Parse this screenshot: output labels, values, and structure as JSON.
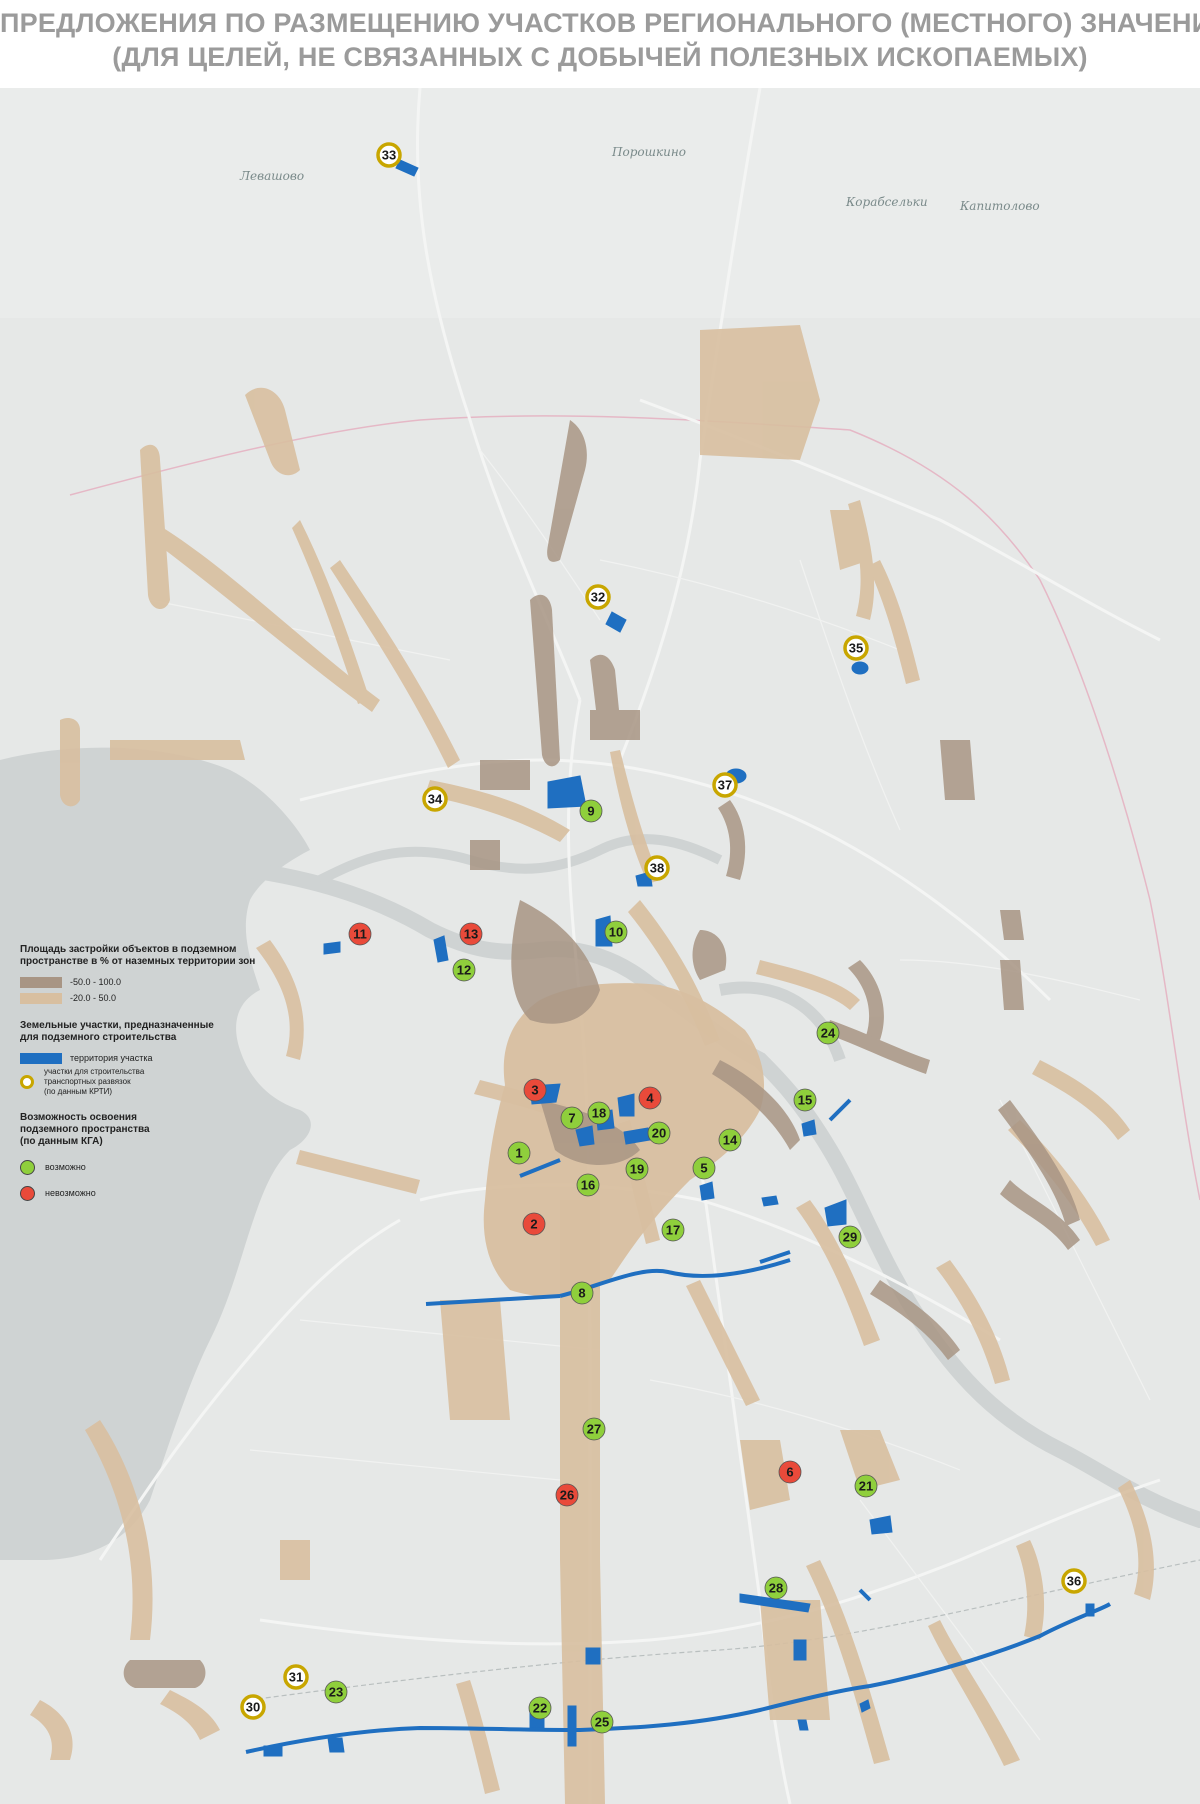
{
  "title": {
    "line1": "ПРЕДЛОЖЕНИЯ ПО РАЗМЕЩЕНИЮ УЧАСТКОВ РЕГИОНАЛЬНОГО (МЕСТНОГО) ЗНАЧЕНИЯ",
    "line2": "(ДЛЯ ЦЕЛЕЙ, НЕ СВЯЗАННЫХ С ДОБЫЧЕЙ ПОЛЕЗНЫХ ИСКОПАЕМЫХ)"
  },
  "colors": {
    "background": "#e6e8e7",
    "water": "#cfd3d3",
    "zone_high": "#a89584",
    "zone_low": "#d8bfa0",
    "site": "#1f6fc1",
    "ring": "#c8a600",
    "possible": "#8fcf3c",
    "impossible": "#e94a3a"
  },
  "places": [
    {
      "name": "Левашово"
    },
    {
      "name": "Порошкино"
    },
    {
      "name": "Корабсельки"
    },
    {
      "name": "Капитолово"
    }
  ],
  "legend": {
    "zone_heading": "Площадь застройки объектов в подземном\nпространстве в % от наземных территории зон",
    "zone_high_label": "-50.0 - 100.0",
    "zone_low_label": "-20.0 - 50.0",
    "plots_heading": "Земельные участки, предназначенные\nдля подземного строительства",
    "plot_label": "территория участка",
    "ring_label": "участки для строительства\nтранспортных развязок\n(по данным КРТИ)",
    "possibility_heading": "Возможность освоения\nподземного пространства\n(по данным КГА)",
    "possible_label": "возможно",
    "impossible_label": "невозможно"
  },
  "markers": [
    {
      "num": "1",
      "type": "possible"
    },
    {
      "num": "2",
      "type": "impossible"
    },
    {
      "num": "3",
      "type": "impossible"
    },
    {
      "num": "4",
      "type": "impossible"
    },
    {
      "num": "5",
      "type": "possible"
    },
    {
      "num": "6",
      "type": "impossible"
    },
    {
      "num": "7",
      "type": "possible"
    },
    {
      "num": "8",
      "type": "possible"
    },
    {
      "num": "9",
      "type": "possible"
    },
    {
      "num": "10",
      "type": "possible"
    },
    {
      "num": "11",
      "type": "impossible"
    },
    {
      "num": "12",
      "type": "possible"
    },
    {
      "num": "13",
      "type": "impossible"
    },
    {
      "num": "14",
      "type": "possible"
    },
    {
      "num": "15",
      "type": "possible"
    },
    {
      "num": "16",
      "type": "possible"
    },
    {
      "num": "17",
      "type": "possible"
    },
    {
      "num": "18",
      "type": "possible"
    },
    {
      "num": "19",
      "type": "possible"
    },
    {
      "num": "20",
      "type": "possible"
    },
    {
      "num": "21",
      "type": "possible"
    },
    {
      "num": "22",
      "type": "possible"
    },
    {
      "num": "23",
      "type": "possible"
    },
    {
      "num": "24",
      "type": "possible"
    },
    {
      "num": "25",
      "type": "possible"
    },
    {
      "num": "26",
      "type": "impossible"
    },
    {
      "num": "27",
      "type": "possible"
    },
    {
      "num": "28",
      "type": "possible"
    },
    {
      "num": "29",
      "type": "possible"
    },
    {
      "num": "30",
      "type": "ring"
    },
    {
      "num": "31",
      "type": "ring"
    },
    {
      "num": "32",
      "type": "ring"
    },
    {
      "num": "33",
      "type": "ring"
    },
    {
      "num": "34",
      "type": "ring"
    },
    {
      "num": "35",
      "type": "ring"
    },
    {
      "num": "36",
      "type": "ring"
    },
    {
      "num": "37",
      "type": "ring"
    },
    {
      "num": "38",
      "type": "ring"
    }
  ]
}
